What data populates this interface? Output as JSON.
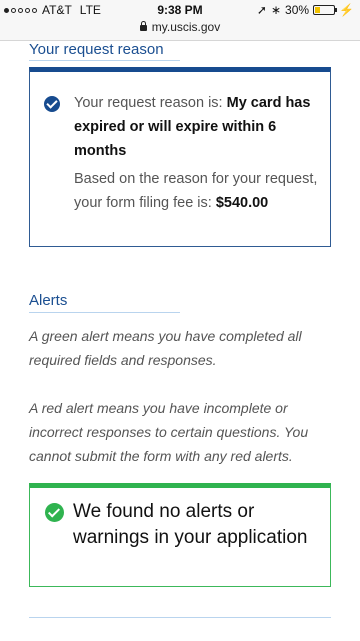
{
  "status_bar": {
    "carrier": "AT&T",
    "network": "LTE",
    "time": "9:38 PM",
    "battery": "30%",
    "battery_level": 0.3
  },
  "url_bar": {
    "url": "my.uscis.gov"
  },
  "request_reason": {
    "heading": "Your request reason",
    "reason_prefix": "Your request reason is: ",
    "reason_value": "My card has expired or will expire within 6 months",
    "fee_prefix": "Based on the reason for your request, your form filing fee is: ",
    "fee_value": "$540.00"
  },
  "alerts": {
    "heading": "Alerts",
    "green_note": "A green alert means you have completed all required fields and responses.",
    "red_note": "A red alert means you have incomplete or incorrect responses to certain questions. You cannot submit the form with any red alerts.",
    "result": "We found no alerts or warnings in your application"
  },
  "colors": {
    "heading_blue": "#1b4f91",
    "box_blue": "#174b8f",
    "success_green": "#2fb34f"
  }
}
